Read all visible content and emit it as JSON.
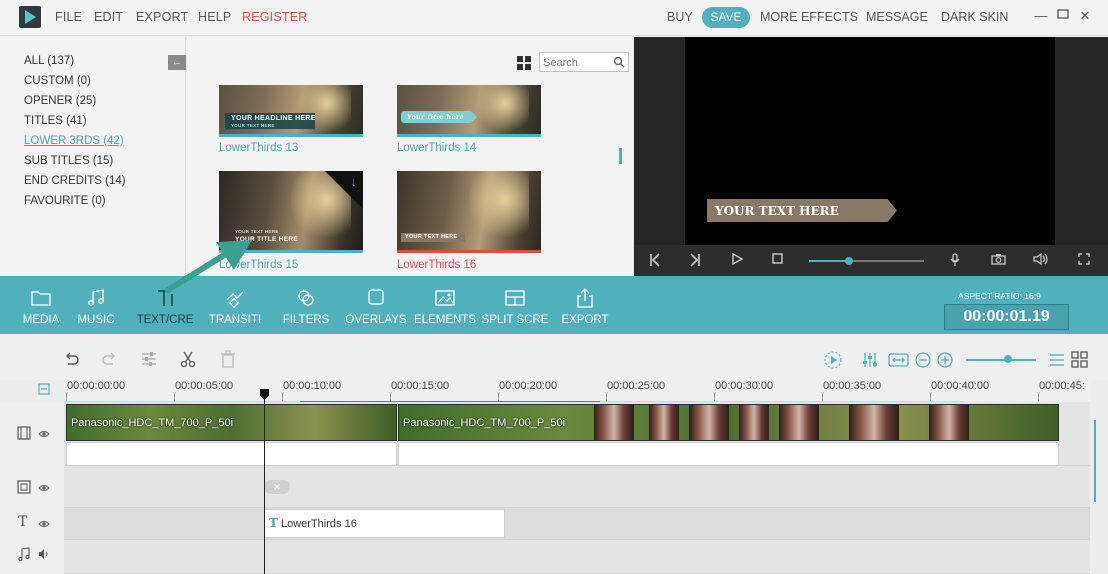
{
  "menu": {
    "items": [
      "FILE",
      "EDIT",
      "EXPORT",
      "HELP"
    ],
    "register": "REGISTER",
    "buy": "BUY",
    "save": "SAVE",
    "more_effects": "MORE EFFECTS",
    "message": "MESSAGE",
    "dark_skin": "DARK SKIN"
  },
  "library": {
    "categories": [
      {
        "label": "ALL (137)"
      },
      {
        "label": "CUSTOM (0)"
      },
      {
        "label": "OPENER (25)"
      },
      {
        "label": "TITLES (41)"
      },
      {
        "label": "LOWER 3RDS (42)",
        "active": true
      },
      {
        "label": "SUB TITLES (15)"
      },
      {
        "label": "END CREDITS (14)"
      },
      {
        "label": "FAVOURITE (0)"
      }
    ],
    "search_placeholder": "Search",
    "thumbnails": [
      {
        "label": "LowerThirds 13",
        "caption": "YOUR HEADLINE HERE",
        "subcaption": "YOUR TEXT HERE"
      },
      {
        "label": "LowerThirds 14",
        "caption": "Your title here"
      },
      {
        "label": "LowerThirds 15",
        "caption": "YOUR TITLE  HERE",
        "subcaption": "YOUR TEXT  HERE"
      },
      {
        "label": "LowerThirds 16",
        "caption": "YOUR TEXT HERE"
      }
    ]
  },
  "preview": {
    "banner_text": "YOUR TEXT  HERE",
    "progress": 0.35
  },
  "toolbar": {
    "tools": [
      "MEDIA",
      "MUSIC",
      "TEXT/CRE",
      "TRANSITI",
      "FILTERS",
      "OVERLAYS",
      "ELEMENTS",
      "SPLIT SCRE",
      "EXPORT"
    ],
    "aspect_ratio": "ASPECT RATIO: 16:9",
    "timecode": "00:00:01.19"
  },
  "timeline": {
    "ruler": [
      "00:00:00:00",
      "00:00:05:00",
      "00:00:10:00",
      "00:00:15:00",
      "00:00:20:00",
      "00:00:25:00",
      "00:00:30:00",
      "00:00:35:00",
      "00:00:40:00",
      "00:00:45:"
    ],
    "video_clips": [
      "Panasonic_HDC_TM_700_P_50i",
      "Panasonic_HDC_TM_700_P_50i"
    ],
    "title_clip": "LowerThirds 16",
    "zoom": 0.6
  }
}
